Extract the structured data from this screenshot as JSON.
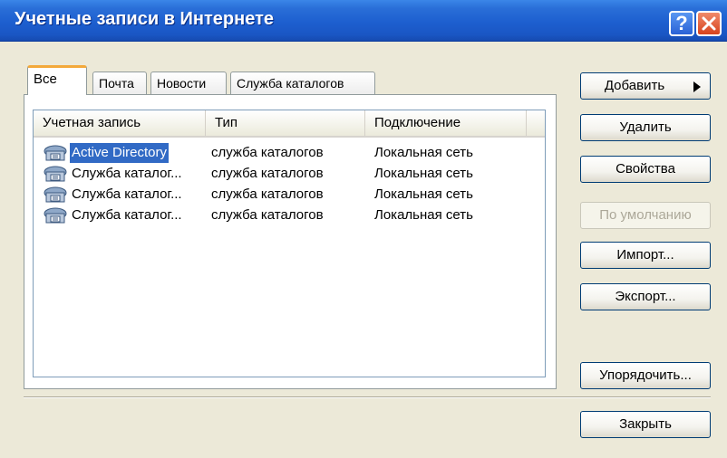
{
  "window": {
    "title": "Учетные записи в Интернете",
    "help_label": "?"
  },
  "tabs": [
    {
      "label": "Все",
      "active": true
    },
    {
      "label": "Почта",
      "active": false
    },
    {
      "label": "Новости",
      "active": false
    },
    {
      "label": "Служба каталогов",
      "active": false
    }
  ],
  "list": {
    "columns": [
      "Учетная запись",
      "Тип",
      "Подключение"
    ],
    "rows": [
      {
        "name": "Active Directory",
        "type": "служба каталогов",
        "connection": "Локальная сеть",
        "selected": true,
        "icon": "directory-service-icon"
      },
      {
        "name": "Служба каталог...",
        "type": "служба каталогов",
        "connection": "Локальная сеть",
        "selected": false,
        "icon": "directory-service-icon"
      },
      {
        "name": "Служба каталог...",
        "type": "служба каталогов",
        "connection": "Локальная сеть",
        "selected": false,
        "icon": "directory-service-icon"
      },
      {
        "name": "Служба каталог...",
        "type": "служба каталогов",
        "connection": "Локальная сеть",
        "selected": false,
        "icon": "directory-service-icon"
      }
    ]
  },
  "buttons": {
    "add": "Добавить",
    "delete": "Удалить",
    "properties": "Свойства",
    "default": "По умолчанию",
    "import": "Импорт...",
    "export": "Экспорт...",
    "order": "Упорядочить...",
    "close": "Закрыть"
  },
  "colors": {
    "titlebar": "#1d5fcf",
    "selection": "#316ac5",
    "active_tab_accent": "#f3a93b",
    "dialog_background": "#ece9d8"
  }
}
